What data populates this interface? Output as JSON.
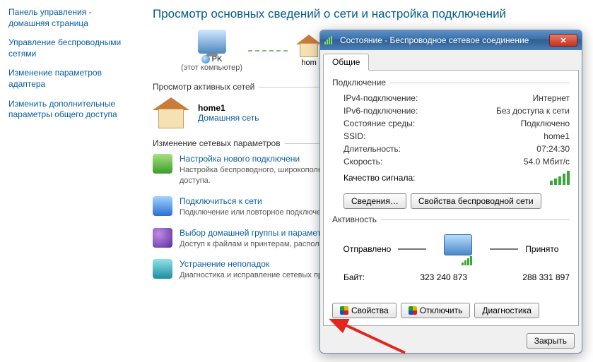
{
  "sidebar": {
    "items": [
      "Панель управления - домашняя страница",
      "Управление беспроводными сетями",
      "Изменение параметров адаптера",
      "Изменить дополнительные параметры общего доступа"
    ]
  },
  "content": {
    "heading": "Просмотр основных сведений о сети и настройка подключений",
    "map": {
      "pc_label": "PK",
      "pc_sub": "(этот компьютер)",
      "home_label": "hom"
    },
    "active_networks_title": "Просмотр активных сетей",
    "network": {
      "name": "home1",
      "type": "Домашняя сеть"
    },
    "change_title": "Изменение сетевых параметров",
    "tasks": [
      {
        "title": "Настройка нового подключени",
        "desc": "Настройка беспроводного, широкополосного, модемного или же настройка маршрутизатора или точки доступа."
      },
      {
        "title": "Подключиться к сети",
        "desc": "Подключение или повторное подключение к беспроводному, сетевому соединению или подключение к VPN."
      },
      {
        "title": "Выбор домашней группы и параметров общего доступа",
        "desc": "Доступ к файлам и принтерам, расположенным на других изменение параметров общего доступа."
      },
      {
        "title": "Устранение неполадок",
        "desc": "Диагностика и исправление сетевых проблем или получение"
      }
    ]
  },
  "dialog": {
    "title": "Состояние - Беспроводное сетевое соединение",
    "tab": "Общие",
    "connection_group": "Подключение",
    "rows": {
      "ipv4_k": "IPv4-подключение:",
      "ipv4_v": "Интернет",
      "ipv6_k": "IPv6-подключение:",
      "ipv6_v": "Без доступа к сети",
      "media_k": "Состояние среды:",
      "media_v": "Подключено",
      "ssid_k": "SSID:",
      "ssid_v": "home1",
      "dur_k": "Длительность:",
      "dur_v": "07:24:30",
      "speed_k": "Скорость:",
      "speed_v": "54.0 Мбит/с",
      "sig_k": "Качество сигнала:"
    },
    "btn_details": "Сведения…",
    "btn_wprops": "Свойства беспроводной сети",
    "activity_group": "Активность",
    "sent_label": "Отправлено",
    "recv_label": "Принято",
    "bytes_label": "Байт:",
    "bytes_sent": "323 240 873",
    "bytes_recv": "288 331 897",
    "btn_props": "Свойства",
    "btn_disable": "Отключить",
    "btn_diag": "Диагностика",
    "btn_close": "Закрыть"
  }
}
